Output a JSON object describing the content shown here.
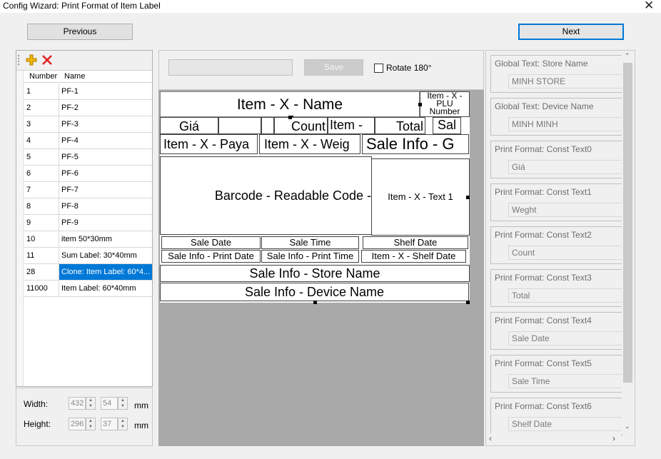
{
  "window": {
    "title": "Config Wizard: Print Format of Item Label",
    "close_glyph": "✕"
  },
  "nav": {
    "previous_label": "Previous",
    "next_label": "Next"
  },
  "toolbar": {
    "add_icon": "add-icon",
    "delete_icon": "delete-icon"
  },
  "list": {
    "col_number": "Number",
    "col_name": "Name",
    "rows": [
      {
        "number": "1",
        "name": "PF-1"
      },
      {
        "number": "2",
        "name": "PF-2"
      },
      {
        "number": "3",
        "name": "PF-3"
      },
      {
        "number": "4",
        "name": "PF-4"
      },
      {
        "number": "5",
        "name": "PF-5"
      },
      {
        "number": "6",
        "name": "PF-6"
      },
      {
        "number": "7",
        "name": "PF-7"
      },
      {
        "number": "8",
        "name": "PF-8"
      },
      {
        "number": "9",
        "name": "PF-9"
      },
      {
        "number": "10",
        "name": "item 50*30mm"
      },
      {
        "number": "11",
        "name": "Sum Label: 30*40mm"
      },
      {
        "number": "28",
        "name": "Clone: Item Label: 60*4..."
      },
      {
        "number": "11000",
        "name": "Item Label: 60*40mm"
      }
    ],
    "selected_number": "28"
  },
  "dims": {
    "width_label": "Width:",
    "height_label": "Height:",
    "width_px": "432",
    "width_mm": "54",
    "height_px": "296",
    "height_mm": "37",
    "unit": "mm"
  },
  "editor": {
    "save_label": "Save",
    "rotate_label": "Rotate 180°",
    "rotate_checked": false
  },
  "label_fields": {
    "item_name": "Item - X - Name",
    "plu_number": "Item - X - PLU Number",
    "gia": "Giá",
    "count": "Count",
    "item_trunc": "Item -",
    "total": "Total",
    "sal": "Sal",
    "payable": "Item - X - Paya",
    "weight": "Item - X - Weig",
    "sale_info_g": "Sale Info - G",
    "barcode": "Barcode - Readable Code -",
    "text1": "Item - X - Text 1",
    "sale_date": "Sale Date",
    "sale_time": "Sale Time",
    "shelf_date": "Shelf Date",
    "print_date": "Sale Info - Print Date",
    "print_time": "Sale Info - Print Time",
    "item_shelf_date": "Item - X - Shelf Date",
    "store_name": "Sale Info - Store Name",
    "device_name": "Sale Info - Device Name"
  },
  "properties": [
    {
      "label": "Global Text: Store Name",
      "value": "MINH STORE"
    },
    {
      "label": "Global Text: Device Name",
      "value": "MINH MINH"
    },
    {
      "label": "Print Format: Const Text0",
      "value": "Giá"
    },
    {
      "label": "Print Format: Const Text1",
      "value": "Weght"
    },
    {
      "label": "Print Format: Const Text2",
      "value": "Count"
    },
    {
      "label": "Print Format: Const Text3",
      "value": "Total"
    },
    {
      "label": "Print Format: Const Text4",
      "value": "Sale Date"
    },
    {
      "label": "Print Format: Const Text5",
      "value": "Sale Time"
    },
    {
      "label": "Print Format: Const Text6",
      "value": "Shelf Date"
    }
  ],
  "colors": {
    "selection": "#0078d7",
    "canvas": "#a9a9a9",
    "add_icon": "#e8a000",
    "delete_icon": "#e02020"
  }
}
